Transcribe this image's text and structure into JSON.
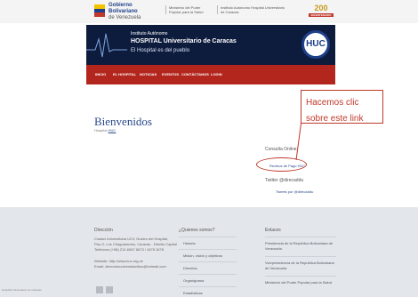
{
  "header": {
    "gov_title_line1": "Gobierno Bolivariano",
    "gov_title_line2": "de Venezuela",
    "ministry": "Ministerio del Poder Popular para la Salud",
    "hospital_small": "Instituto Autónomo Hospital Universitario de Caracas",
    "logo_text": "200",
    "logo_band": "BICENTENARIO"
  },
  "banner": {
    "line1": "Instituto Autónomo",
    "line2": "HOSPITAL Universitario de Caracas",
    "line3": "El Hospital es del pueblo",
    "seal_text": "HUC"
  },
  "nav": {
    "items": [
      "INICIO",
      "EL HOSPITAL",
      "NOTICIAS",
      "EVENTOS",
      "CONTÁCTANOS",
      "LOGIN"
    ]
  },
  "main": {
    "heading": "Bienvenidos",
    "sub_prefix": "Hospital",
    "sub_link": "HUC"
  },
  "callout": {
    "line1": "Hacemos clic",
    "line2": "sobre este link",
    "color": "#c0392b"
  },
  "sidebar": {
    "consulta_title": "Consulta Online",
    "consulta_link": "Recibos de Pago HUC",
    "twitter_title": "Twitter @direcaddu",
    "twitter_link": "Tweets por @direcaddu"
  },
  "footer": {
    "col1_title": "Dirección",
    "col1_lines": [
      "Ciudad Universitaria UCV, Núcleo del Hospital,",
      "Piso 2, Los Chaguaramos, Caracas - Distrito Capital",
      "Teléfonos (+58) 212-6067 8673 / 1678 1678"
    ],
    "col1_link1": "Ciudad Universitaria",
    "col1_link2": "Teléfonos",
    "col1_web": "Website: http://www.huc.org.ve",
    "col1_email": "Email: direcciónuniversidadhuc@hotmail.com",
    "col2_title": "¿Quienes somos?",
    "col2_links": [
      "Historia",
      "Misión, visión y objetivos",
      "Directiva",
      "Organigrama",
      "Estadísticas"
    ],
    "col3_title": "Enlaces",
    "col3_links": [
      "Presidencia de la República Bolivariana de Venezuela",
      "Vicepresidencia de la República Bolivariana de Venezuela",
      "Ministerio del Poder Popular para la Salud"
    ],
    "bottom_note": "Hospital Universitario de Caracas"
  }
}
